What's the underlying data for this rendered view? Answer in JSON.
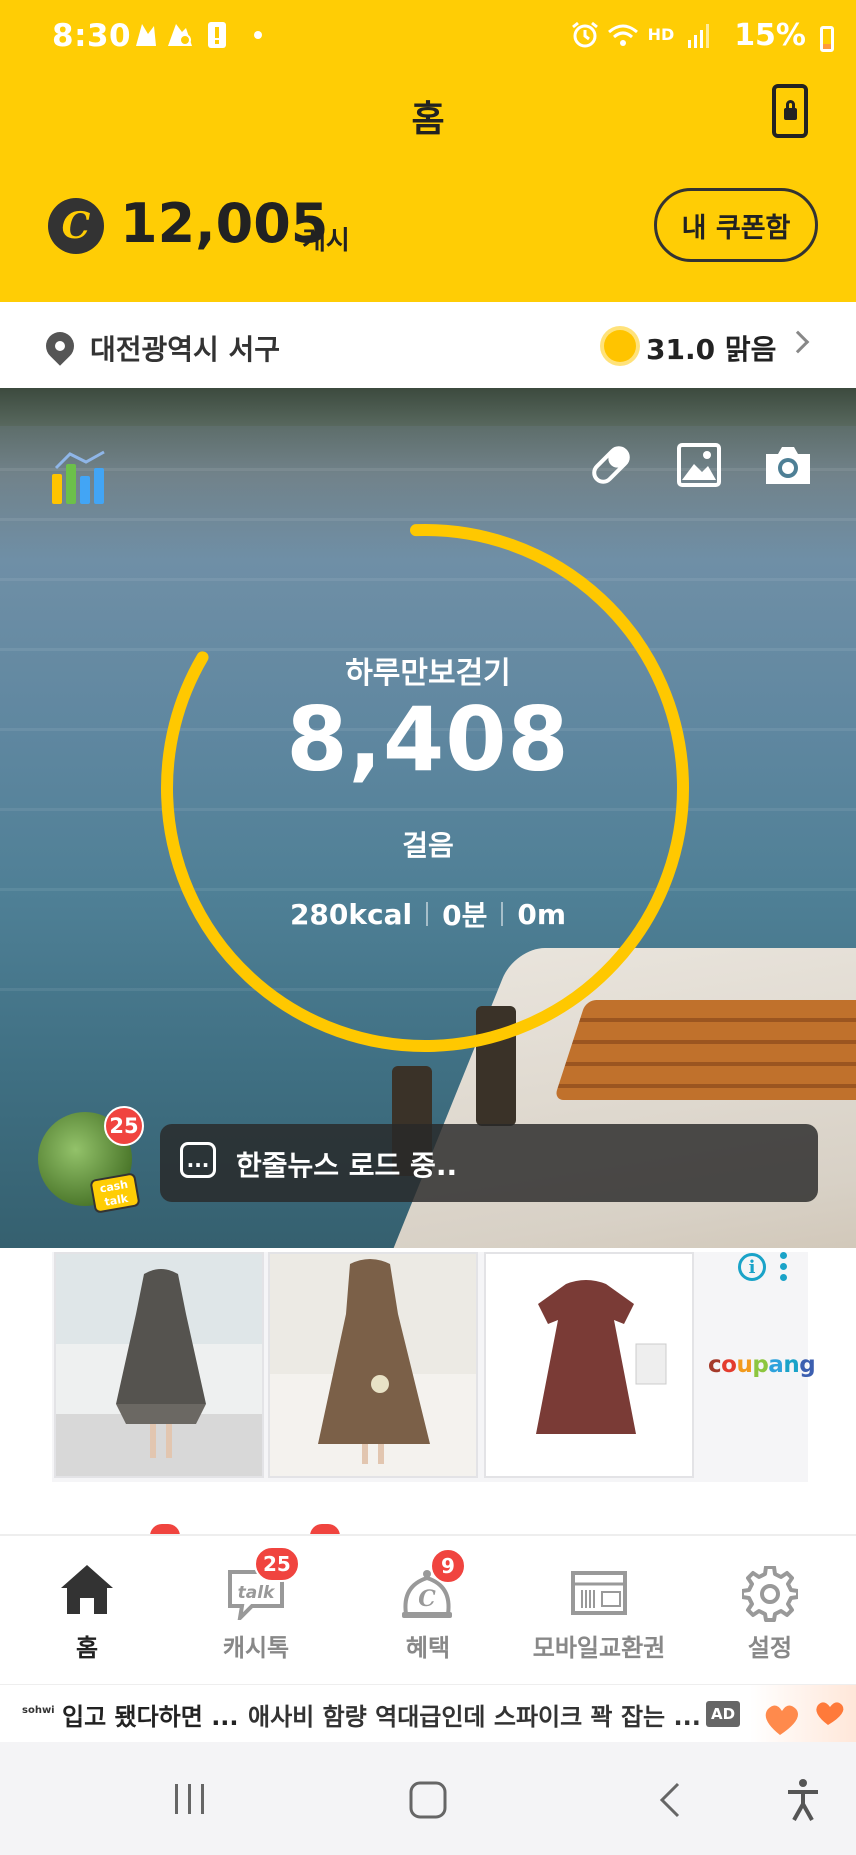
{
  "status_bar": {
    "time": "8:30",
    "battery": "15%",
    "icons": [
      "notification-icon",
      "notification-icon",
      "battery-alert-icon",
      "dot-icon",
      "alarm-icon",
      "wifi-icon",
      "hd-voice-icon",
      "signal-icon",
      "battery-icon"
    ],
    "hd_text": "HD"
  },
  "header": {
    "title": "홈",
    "lock_icon": "phone-lock-icon"
  },
  "cash": {
    "amount": "12,005",
    "unit": "캐시",
    "coin_symbol": "C",
    "coupon_button": "내 쿠폰함"
  },
  "location": {
    "place": "대전광역시 서구",
    "weather": "31.0 맑음"
  },
  "pedometer": {
    "label": "하루만보걷기",
    "steps": "8,408",
    "unit": "걸음",
    "progress_fraction": 0.84,
    "kcal": "280kcal",
    "minutes": "0분",
    "distance": "0m"
  },
  "news": {
    "badge": "25",
    "dots": "...",
    "text": "한줄뉴스 로드 중..",
    "tag_line1": "cash",
    "tag_line2": "talk"
  },
  "ad": {
    "brand": "coupang",
    "info": "i"
  },
  "nav": {
    "items": [
      {
        "label": "홈",
        "icon": "home-icon",
        "active": true
      },
      {
        "label": "캐시톡",
        "icon": "talk-icon",
        "badge": "25"
      },
      {
        "label": "혜택",
        "icon": "benefit-icon",
        "badge": "9"
      },
      {
        "label": "모바일교환권",
        "icon": "voucher-icon"
      },
      {
        "label": "설정",
        "icon": "gear-icon"
      }
    ],
    "talk_word": "talk"
  },
  "bottom_ad": {
    "brand": "sohwi",
    "title": "입고 됐다하면 ...",
    "desc": "애사비 함량 역대급인데 스파이크 꽉 잡는 ...",
    "ad_label": "AD"
  },
  "colors": {
    "brand_yellow": "#FFCD05",
    "badge_red": "#F0443F",
    "ring_yellow": "#FFC800"
  }
}
